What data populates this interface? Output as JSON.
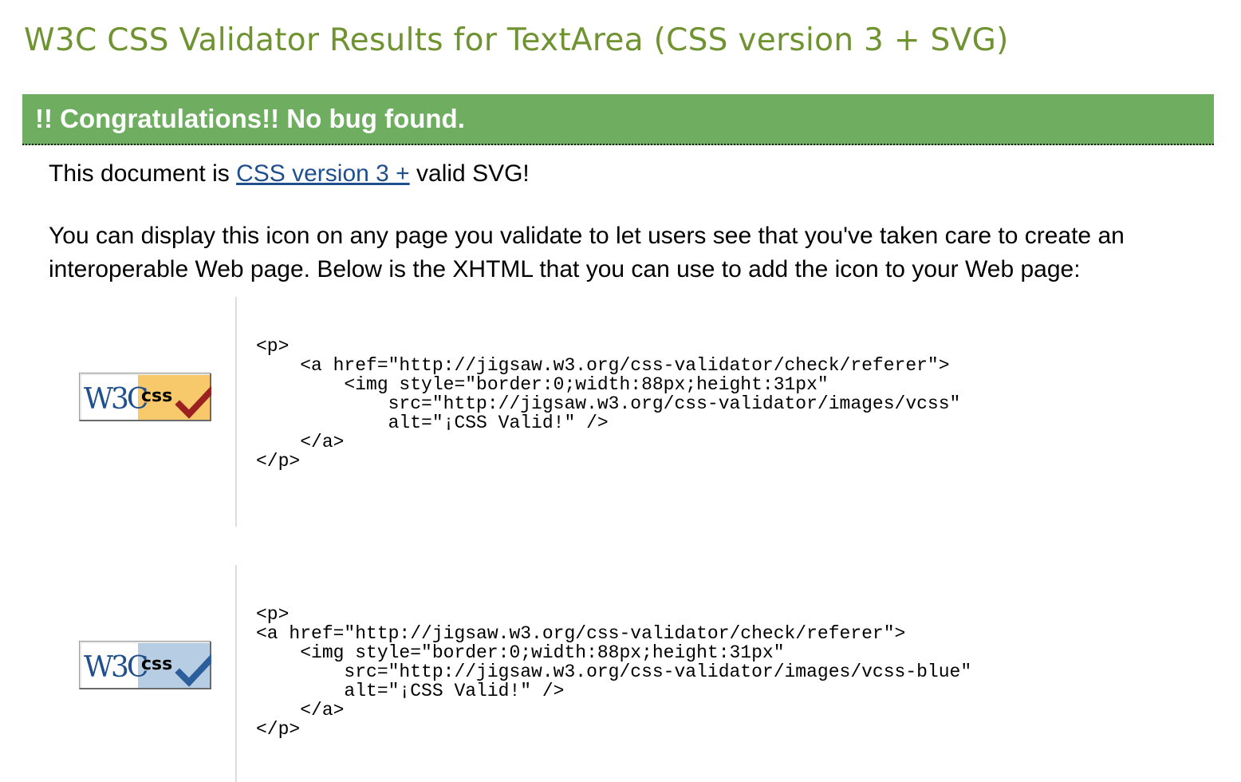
{
  "page": {
    "title": "W3C CSS Validator Results for TextArea (CSS version 3 + SVG)"
  },
  "congrats": {
    "text": "!! Congratulations!! No bug found."
  },
  "validity": {
    "prefix": "This document is ",
    "link_text": "CSS version 3 +",
    "suffix": " valid SVG!"
  },
  "info": {
    "text": "You can display this icon on any page you validate to let users see that you've taken care to create an interoperable Web page. Below is the XHTML that you can use to add the icon to your Web page:"
  },
  "badges": [
    {
      "logo_text": "W3C",
      "label_text": "css",
      "variant": "gold",
      "panel_color": "#f7c96a",
      "check_color": "#9b2121",
      "code": "<p>\n    <a href=\"http://jigsaw.w3.org/css-validator/check/referer\">\n        <img style=\"border:0;width:88px;height:31px\"\n            src=\"http://jigsaw.w3.org/css-validator/images/vcss\"\n            alt=\"¡CSS Valid!\" />\n    </a>\n</p>"
    },
    {
      "logo_text": "W3C",
      "label_text": "css",
      "variant": "blue",
      "panel_color": "#b6cde4",
      "check_color": "#2d5e9c",
      "code": "<p>\n<a href=\"http://jigsaw.w3.org/css-validator/check/referer\">\n    <img style=\"border:0;width:88px;height:31px\"\n        src=\"http://jigsaw.w3.org/css-validator/images/vcss-blue\"\n        alt=\"¡CSS Valid!\" />\n    </a>\n</p>"
    }
  ],
  "colors": {
    "title": "#6f9330",
    "congrats_bar": "#6fae61",
    "link": "#1f4f8d"
  }
}
